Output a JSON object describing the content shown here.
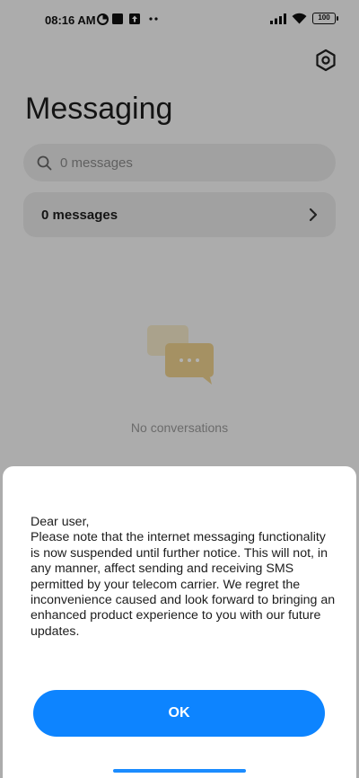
{
  "status_bar": {
    "time": "08:16 AM",
    "battery": "100"
  },
  "header": {
    "title": "Messaging"
  },
  "search": {
    "placeholder": "0 messages"
  },
  "messages_row": {
    "label": "0 messages"
  },
  "empty_state": {
    "text": "No conversations"
  },
  "dialog": {
    "greeting": "Dear user,",
    "body": "Please note that the internet messaging functionality is now suspended until further notice. This will not, in any manner, affect sending and receiving SMS permitted by your telecom carrier. We regret the inconvenience caused and look forward to bringing an enhanced product experience to you with our future updates.",
    "ok_label": "OK"
  },
  "colors": {
    "accent": "#0d84ff",
    "illustration": "#f0d89a"
  }
}
